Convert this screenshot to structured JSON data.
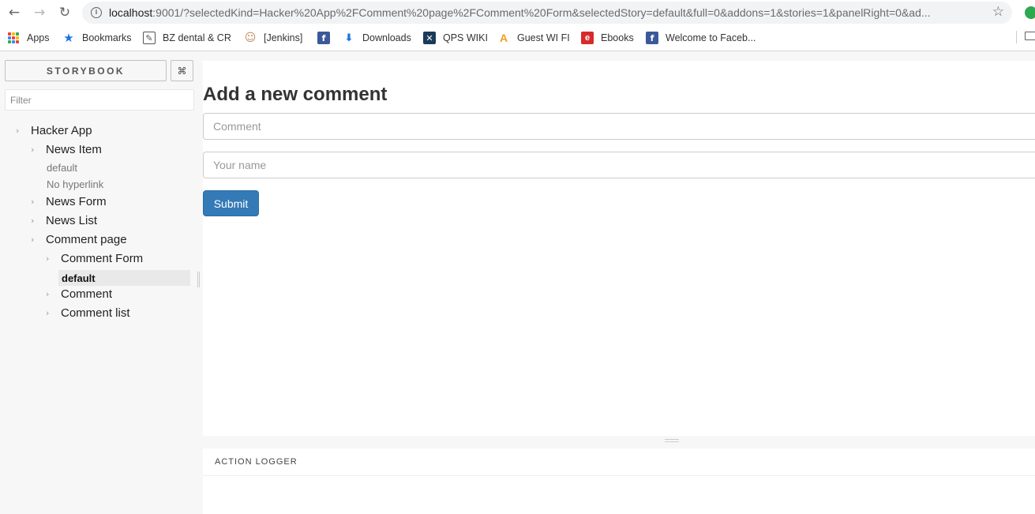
{
  "browser": {
    "url_host": "localhost",
    "url_rest": ":9001/?selectedKind=Hacker%20App%2FComment%20page%2FComment%20Form&selectedStory=default&full=0&addons=1&stories=1&panelRight=0&ad...",
    "back_glyph": "←",
    "forward_glyph": "→",
    "reload_glyph": "↻",
    "info_glyph": "i",
    "star_glyph": "☆"
  },
  "bookmarks": {
    "items": [
      {
        "label": "Apps",
        "icon": "apps-grid-icon"
      },
      {
        "label": "Bookmarks",
        "icon": "star-icon",
        "glyph": "★",
        "color": "#1a73e8"
      },
      {
        "label": "BZ dental & CR",
        "icon": "bz-dental-icon",
        "glyph": "✎",
        "color": "#555555"
      },
      {
        "label": "[Jenkins]",
        "icon": "jenkins-icon",
        "glyph": "☺",
        "color": "#c48a5a"
      },
      {
        "label": "",
        "icon": "facebook-icon",
        "glyph": "f",
        "color": "#3b5998"
      },
      {
        "label": "Downloads",
        "icon": "download-icon",
        "glyph": "⬇",
        "color": "#1a73e8"
      },
      {
        "label": "QPS WIKI",
        "icon": "qps-wiki-icon",
        "glyph": "✕",
        "color": "#1b3a5c"
      },
      {
        "label": "Guest WI FI",
        "icon": "guest-wifi-icon",
        "glyph": "A",
        "color": "#f0a020"
      },
      {
        "label": "Ebooks",
        "icon": "ebooks-icon",
        "glyph": "e",
        "color": "#d62b2b"
      },
      {
        "label": "Welcome to Faceb...",
        "icon": "facebook-icon",
        "glyph": "f",
        "color": "#3b5998"
      }
    ]
  },
  "sidebar": {
    "title": "STORYBOOK",
    "shortcut_glyph": "⌘",
    "filter_placeholder": "Filter",
    "chevron_glyph": "›",
    "tree": {
      "hacker_app": "Hacker App",
      "news_item": "News Item",
      "news_item_default": "default",
      "news_item_no_hyperlink": "No hyperlink",
      "news_form": "News Form",
      "news_list": "News List",
      "comment_page": "Comment page",
      "comment_form": "Comment Form",
      "comment_form_default": "default",
      "comment": "Comment",
      "comment_list": "Comment list"
    }
  },
  "preview": {
    "title": "Add a new comment",
    "comment_placeholder": "Comment",
    "name_placeholder": "Your name",
    "submit_label": "Submit",
    "submit_color": "#337ab7"
  },
  "addons": {
    "active_tab": "ACTION LOGGER"
  }
}
